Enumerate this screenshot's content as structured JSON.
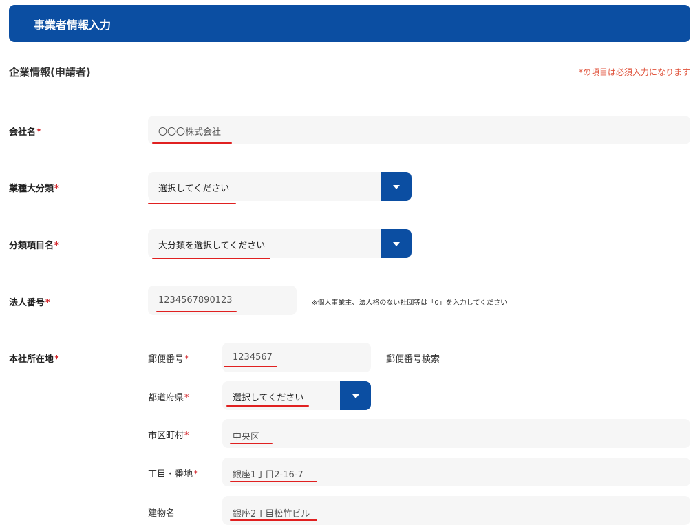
{
  "header": {
    "title": "事業者情報入力",
    "color": "#0b4ea2"
  },
  "section": {
    "title": "企業情報(申請者)",
    "required_note": "*の項目は必須入力になります"
  },
  "required_mark": "*",
  "fields": {
    "company_name": {
      "label": "会社名",
      "placeholder": "〇〇〇株式会社"
    },
    "industry_major": {
      "label": "業種大分類",
      "value": "選択してください"
    },
    "category_item": {
      "label": "分類項目名",
      "value": "大分類を選択してください"
    },
    "corporate_number": {
      "label": "法人番号",
      "placeholder": "1234567890123",
      "note": "※個人事業主、法人格のない社団等は「0」を入力してください"
    },
    "head_office": {
      "label": "本社所在地",
      "postal_code": {
        "label": "郵便番号",
        "placeholder": "1234567",
        "search_link": "郵便番号検索"
      },
      "prefecture": {
        "label": "都道府県",
        "value": "選択してください"
      },
      "city": {
        "label": "市区町村",
        "placeholder": "中央区"
      },
      "street": {
        "label": "丁目・番地",
        "placeholder": "銀座1丁目2-16-7"
      },
      "building": {
        "label": "建物名",
        "placeholder": "銀座2丁目松竹ビル"
      }
    }
  },
  "colors": {
    "accent": "#0b4ea2",
    "required": "#d3242a",
    "note": "#e0533c",
    "annotation": "#e02020"
  }
}
